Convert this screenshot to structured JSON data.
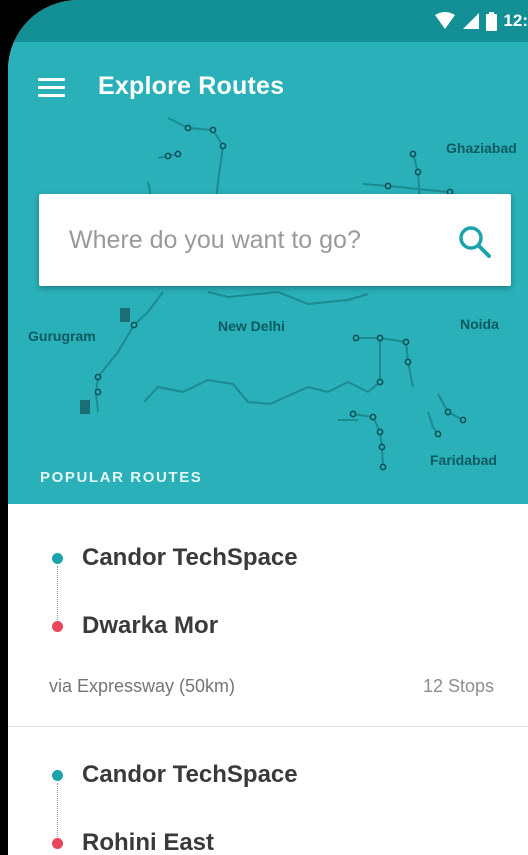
{
  "status_bar": {
    "time": "12:"
  },
  "header": {
    "title": "Explore Routes"
  },
  "map_labels": {
    "ghaziabad": "Ghaziabad",
    "gurugram": "Gurugram",
    "new_delhi": "New Delhi",
    "noida": "Noida",
    "faridabad": "Faridabad"
  },
  "search": {
    "placeholder": "Where do you want to go?"
  },
  "popular": {
    "label": "POPULAR ROUTES"
  },
  "routes": [
    {
      "from": "Candor TechSpace",
      "to": "Dwarka Mor",
      "via": "via Expressway (50km)",
      "stops": "12 Stops"
    },
    {
      "from": "Candor TechSpace",
      "to": "Rohini East"
    }
  ],
  "colors": {
    "primary": "#29b0b8",
    "status_bar": "#138f96",
    "start_dot": "#1aa3ab",
    "end_dot": "#e8465a"
  }
}
